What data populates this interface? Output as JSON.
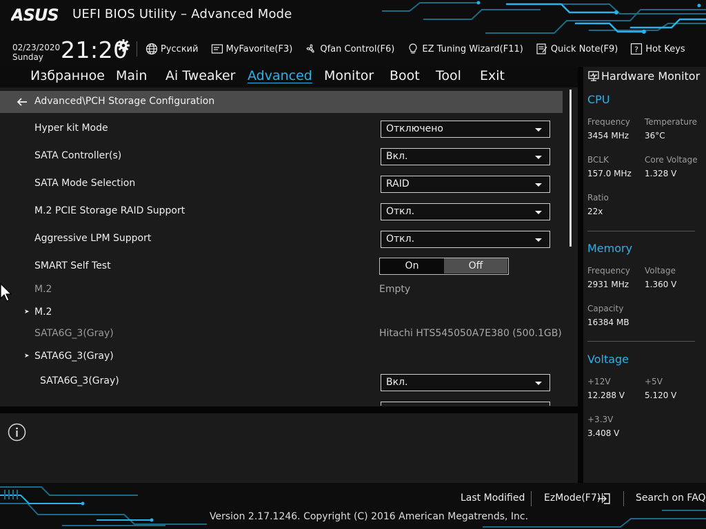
{
  "header": {
    "brand": "ASUS",
    "title": "UEFI BIOS Utility – Advanced Mode",
    "date": "02/23/2020",
    "day": "Sunday",
    "time": "21:20",
    "tools": {
      "language": "Русский",
      "myfavorite": "MyFavorite(F3)",
      "qfan": "Qfan Control(F6)",
      "ez_tuning": "EZ Tuning Wizard(F11)",
      "quick_note": "Quick Note(F9)",
      "hot_keys": "Hot Keys"
    }
  },
  "tabs": {
    "favorites": "Избранное",
    "main": "Main",
    "ai_tweaker": "Ai Tweaker",
    "advanced": "Advanced",
    "monitor": "Monitor",
    "boot": "Boot",
    "tool": "Tool",
    "exit": "Exit",
    "active": "Advanced"
  },
  "content": {
    "breadcrumb": "Advanced\\PCH Storage Configuration",
    "settings": {
      "hyper_kit": {
        "label": "Hyper kit Mode",
        "value": "Отключено"
      },
      "sata_controller": {
        "label": "SATA Controller(s)",
        "value": "Вкл."
      },
      "sata_mode": {
        "label": "SATA Mode Selection",
        "value": "RAID"
      },
      "m2_raid": {
        "label": "M.2 PCIE Storage RAID Support",
        "value": "Откл."
      },
      "lpm": {
        "label": "Aggressive LPM Support",
        "value": "Откл."
      },
      "smart": {
        "label": "SMART Self Test",
        "on": "On",
        "off": "Off",
        "selected": "Off"
      },
      "m2_info": {
        "label": "M.2",
        "value": "Empty"
      },
      "m2_sub": {
        "label": "M.2"
      },
      "sata6g_info": {
        "label": "SATA6G_3(Gray)",
        "value": "Hitachi HTS545050A7E380 (500.1GB)"
      },
      "sata6g_sub": {
        "label": "SATA6G_3(Gray)"
      },
      "sata6g_port": {
        "label": "SATA6G_3(Gray)",
        "value": "Вкл."
      }
    }
  },
  "hardware_monitor": {
    "title": "Hardware Monitor",
    "cpu": {
      "heading": "CPU",
      "frequency_label": "Frequency",
      "frequency": "3454 MHz",
      "temperature_label": "Temperature",
      "temperature": "36°C",
      "bclk_label": "BCLK",
      "bclk": "157.0 MHz",
      "core_voltage_label": "Core Voltage",
      "core_voltage": "1.328 V",
      "ratio_label": "Ratio",
      "ratio": "22x"
    },
    "memory": {
      "heading": "Memory",
      "frequency_label": "Frequency",
      "frequency": "2931 MHz",
      "voltage_label": "Voltage",
      "voltage": "1.360 V",
      "capacity_label": "Capacity",
      "capacity": "16384 MB"
    },
    "voltage": {
      "heading": "Voltage",
      "v12_label": "+12V",
      "v12": "12.288 V",
      "v5_label": "+5V",
      "v5": "5.120 V",
      "v33_label": "+3.3V",
      "v33": "3.408 V"
    }
  },
  "footer": {
    "last_modified": "Last Modified",
    "ezmode": "EzMode(F7)|",
    "search_faq": "Search on FAQ",
    "copyright": "Version 2.17.1246. Copyright (C) 2016 American Megatrends, Inc."
  },
  "colors": {
    "accent": "#2ab2ea",
    "background": "#1b1b1b",
    "header": "#0d0d0d",
    "breadcrumb_bar": "#4b4b4b"
  },
  "icons": [
    "asus-logo",
    "gear-icon",
    "globe-icon",
    "myfavorite-icon",
    "fan-icon",
    "bulb-icon",
    "note-icon",
    "help-icon",
    "back-arrow-icon",
    "monitor-icon",
    "info-icon",
    "exit-icon",
    "mouse-cursor"
  ]
}
